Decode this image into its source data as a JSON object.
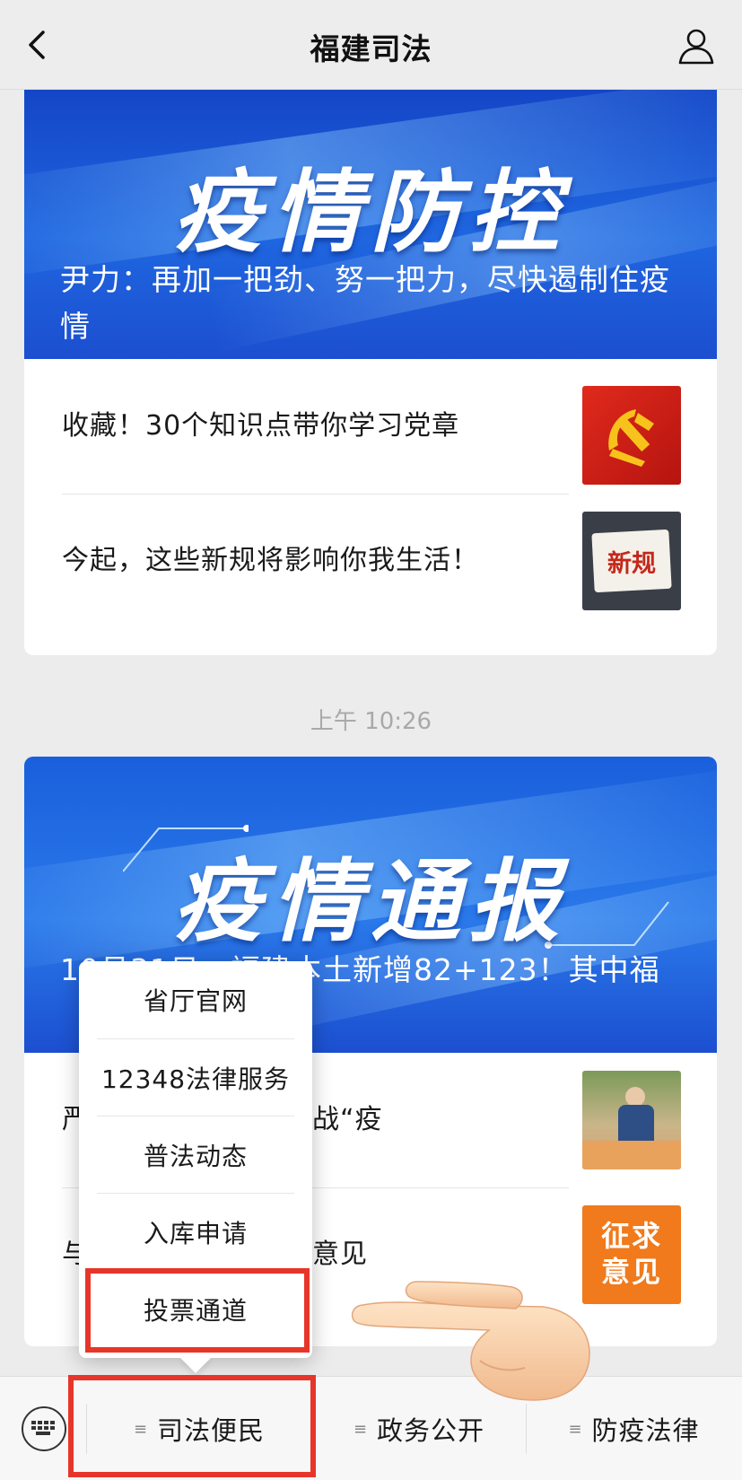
{
  "header": {
    "title": "福建司法"
  },
  "feed": {
    "card1": {
      "banner_title": "疫情防控",
      "banner_subtitle": "尹力：再加一把劲、努一把力，尽快遏制住疫情",
      "items": [
        {
          "title": "收藏！30个知识点带你学习党章",
          "thumb_icon": "party-emblem-icon"
        },
        {
          "title": "今起，这些新规将影响你我生活！",
          "thumb_label": "新规"
        }
      ]
    },
    "timestamp": "上午 10:26",
    "card2": {
      "banner_title": "疫情通报",
      "banner_subtitle": "10月31日，福建本土新增82+123！其中福",
      "items": [
        {
          "title": "严…直击福州另一场战“疫",
          "thumb_icon": "market-photo-icon"
        },
        {
          "title": "与…律草案公开征求意见",
          "thumb_label": "征求意见"
        }
      ]
    }
  },
  "popup_menu": {
    "items": [
      "省厅官网",
      "12348法律服务",
      "普法动态",
      "入库申请",
      "投票通道"
    ],
    "highlighted_index": 4
  },
  "bottom_bar": {
    "tabs": [
      "司法便民",
      "政务公开",
      "防疫法律"
    ],
    "highlighted_tab": 0
  },
  "colors": {
    "highlight": "#e8352a",
    "banner_blue": "#1f66e0"
  }
}
